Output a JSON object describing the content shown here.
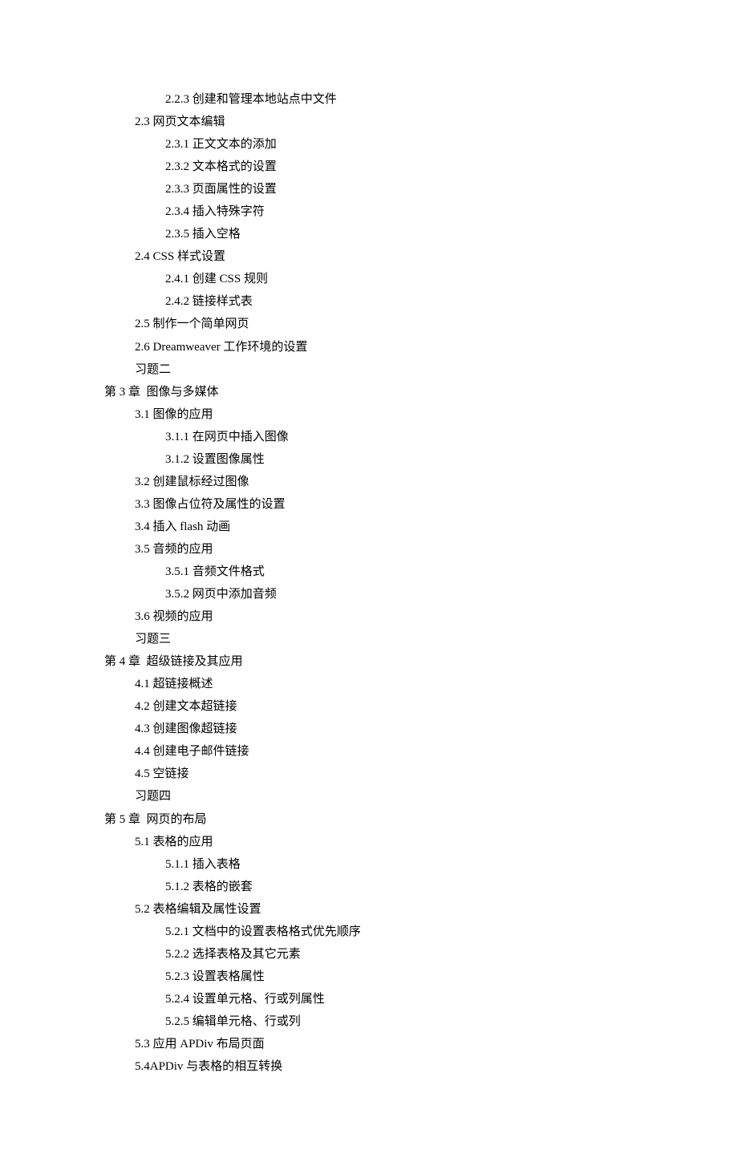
{
  "toc": [
    {
      "level": 2,
      "text": "2.2.3 创建和管理本地站点中文件"
    },
    {
      "level": 1,
      "text": "2.3 网页文本编辑"
    },
    {
      "level": 2,
      "text": "2.3.1 正文文本的添加"
    },
    {
      "level": 2,
      "text": "2.3.2 文本格式的设置"
    },
    {
      "level": 2,
      "text": "2.3.3 页面属性的设置"
    },
    {
      "level": 2,
      "text": "2.3.4 插入特殊字符"
    },
    {
      "level": 2,
      "text": "2.3.5 插入空格"
    },
    {
      "level": 1,
      "text": "2.4 CSS 样式设置"
    },
    {
      "level": 2,
      "text": "2.4.1 创建 CSS 规则"
    },
    {
      "level": 2,
      "text": "2.4.2 链接样式表"
    },
    {
      "level": 1,
      "text": "2.5 制作一个简单网页"
    },
    {
      "level": 1,
      "text": "2.6 Dreamweaver 工作环境的设置"
    },
    {
      "level": 1,
      "text": "习题二"
    },
    {
      "level": 0,
      "text": "第 3 章  图像与多媒体"
    },
    {
      "level": 1,
      "text": "3.1 图像的应用"
    },
    {
      "level": 2,
      "text": "3.1.1 在网页中插入图像"
    },
    {
      "level": 2,
      "text": "3.1.2 设置图像属性"
    },
    {
      "level": 1,
      "text": "3.2 创建鼠标经过图像"
    },
    {
      "level": 1,
      "text": "3.3 图像占位符及属性的设置"
    },
    {
      "level": 1,
      "text": "3.4 插入 flash 动画"
    },
    {
      "level": 1,
      "text": "3.5 音频的应用"
    },
    {
      "level": 2,
      "text": "3.5.1 音频文件格式"
    },
    {
      "level": 2,
      "text": "3.5.2 网页中添加音频"
    },
    {
      "level": 1,
      "text": "3.6 视频的应用"
    },
    {
      "level": 1,
      "text": "习题三"
    },
    {
      "level": 0,
      "text": "第 4 章  超级链接及其应用"
    },
    {
      "level": 1,
      "text": "4.1 超链接概述"
    },
    {
      "level": 1,
      "text": "4.2 创建文本超链接"
    },
    {
      "level": 1,
      "text": "4.3 创建图像超链接"
    },
    {
      "level": 1,
      "text": "4.4 创建电子邮件链接"
    },
    {
      "level": 1,
      "text": "4.5 空链接"
    },
    {
      "level": 1,
      "text": "习题四"
    },
    {
      "level": 0,
      "text": "第 5 章  网页的布局"
    },
    {
      "level": 1,
      "text": "5.1 表格的应用"
    },
    {
      "level": 2,
      "text": "5.1.1 插入表格"
    },
    {
      "level": 2,
      "text": "5.1.2 表格的嵌套"
    },
    {
      "level": 1,
      "text": "5.2 表格编辑及属性设置"
    },
    {
      "level": 2,
      "text": "5.2.1 文档中的设置表格格式优先顺序"
    },
    {
      "level": 2,
      "text": "5.2.2 选择表格及其它元素"
    },
    {
      "level": 2,
      "text": "5.2.3 设置表格属性"
    },
    {
      "level": 2,
      "text": "5.2.4 设置单元格、行或列属性"
    },
    {
      "level": 2,
      "text": "5.2.5 编辑单元格、行或列"
    },
    {
      "level": 1,
      "text": "5.3 应用 APDiv 布局页面"
    },
    {
      "level": 1,
      "text": "5.4APDiv 与表格的相互转换"
    }
  ]
}
